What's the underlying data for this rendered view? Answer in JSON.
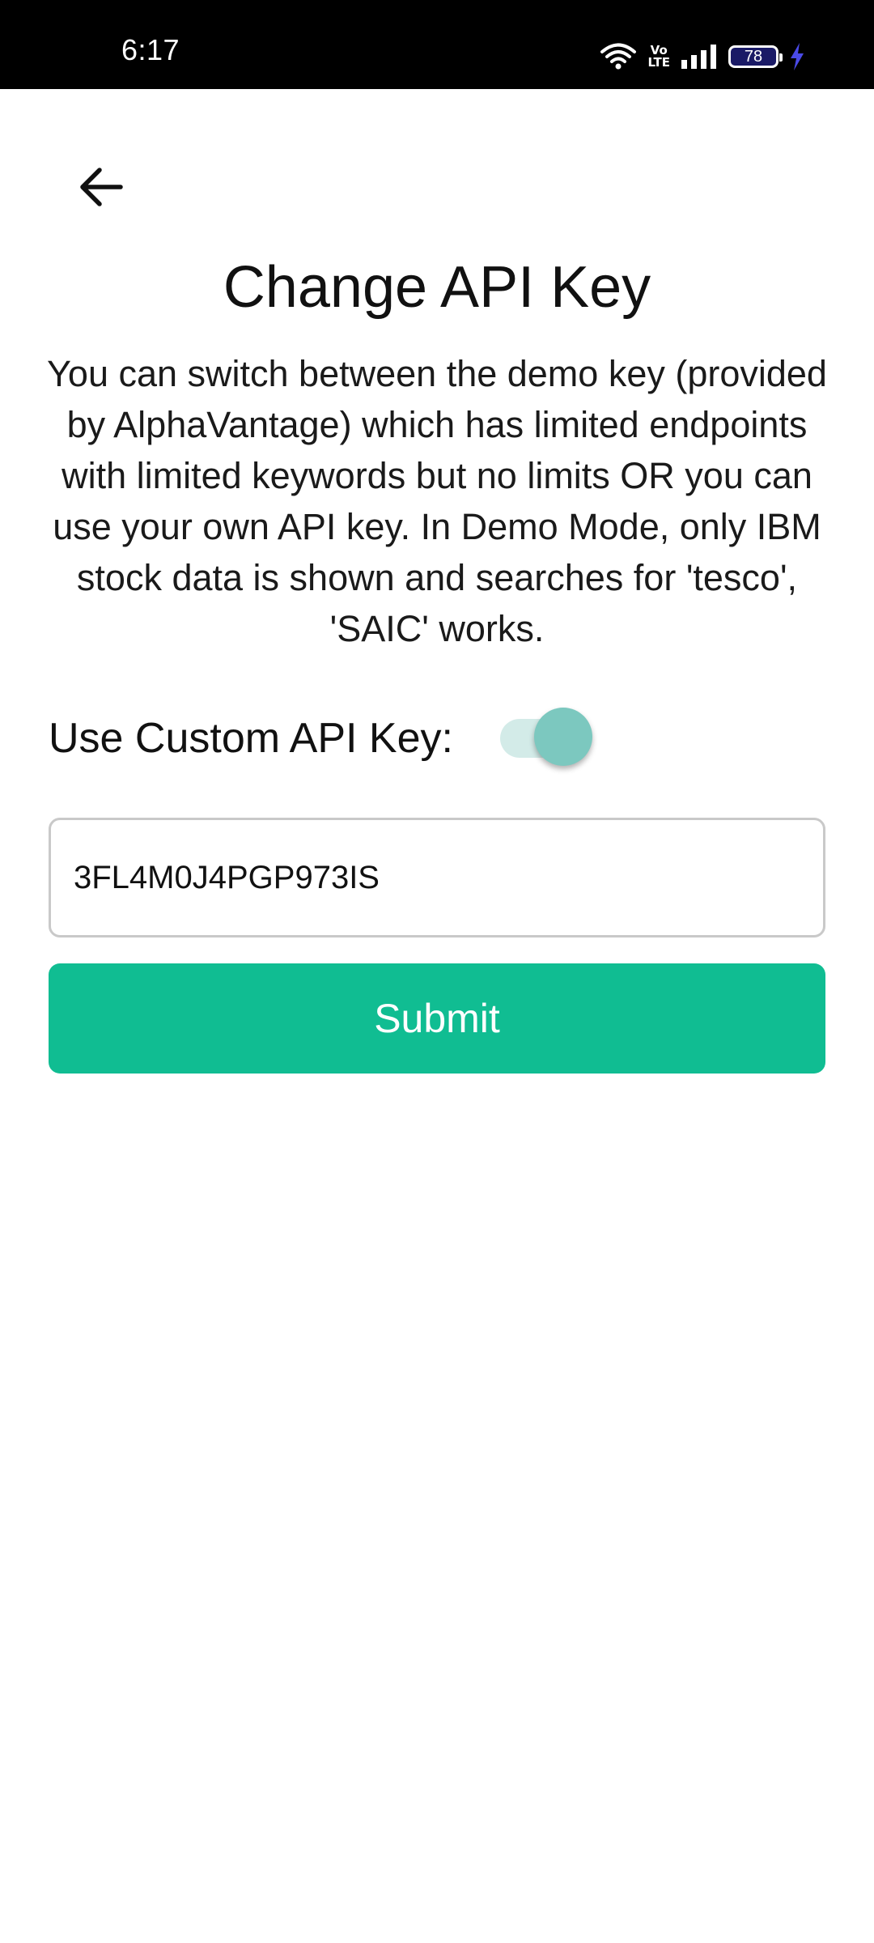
{
  "status_bar": {
    "time": "6:17",
    "volte_top": "Vo",
    "volte_bottom": "LTE",
    "battery_level": "78",
    "icons": [
      "wifi-icon",
      "volte-icon",
      "signal-icon",
      "battery-icon",
      "charging-bolt-icon"
    ],
    "battery_fill_color": "#1a1a66",
    "bolt_color": "#4a4ae8"
  },
  "header": {
    "back_icon": "arrow-left-icon",
    "title": "Change API Key"
  },
  "description": "You can switch between the demo key (provided by AlphaVantage) which has limited endpoints with limited keywords but no limits OR you can use your own API key. In Demo Mode, only IBM stock data is shown and searches for 'tesco', 'SAIC' works.",
  "custom_key": {
    "label": "Use Custom API Key:",
    "enabled": true,
    "value": "3FL4M0J4PGP973IS"
  },
  "submit_label": "Submit",
  "colors": {
    "accent": "#10bd92",
    "toggle_thumb": "#7cc8bf",
    "toggle_track": "#d3ebe8"
  }
}
